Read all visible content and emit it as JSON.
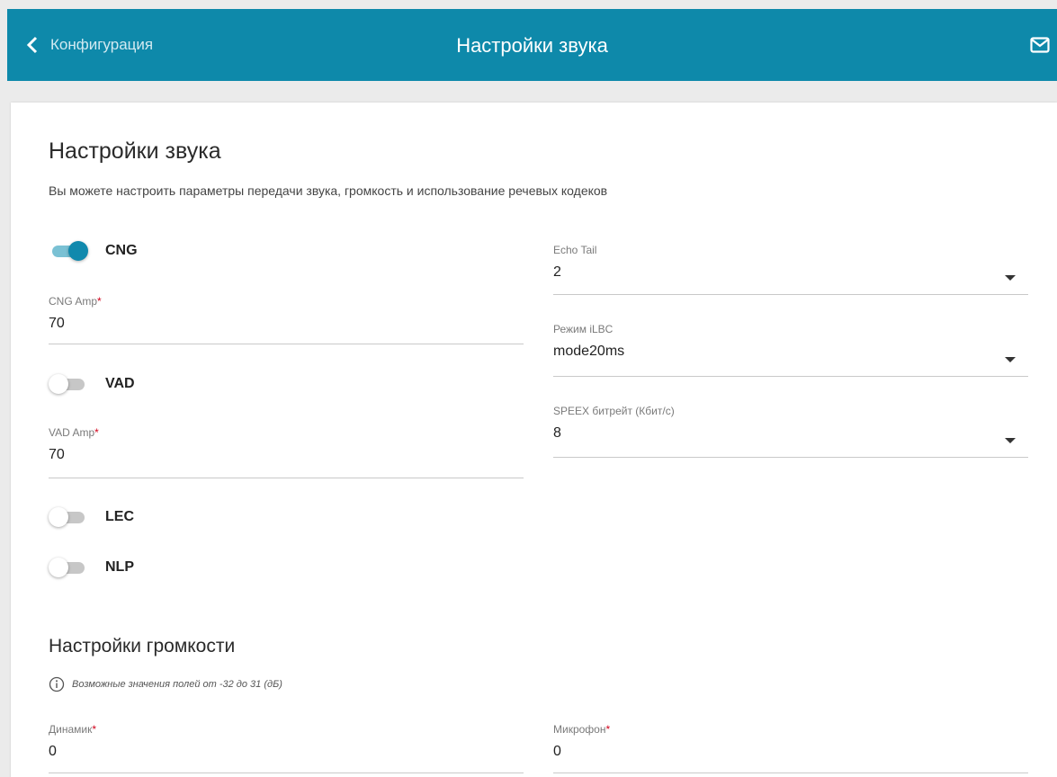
{
  "header": {
    "back_label": "Конфигурация",
    "title": "Настройки звука"
  },
  "section_sound": {
    "title": "Настройки звука",
    "description": "Вы можете настроить параметры передачи звука, громкость и использование речевых кодеков"
  },
  "toggles": {
    "cng": {
      "label": "CNG",
      "on": true
    },
    "vad": {
      "label": "VAD",
      "on": false
    },
    "lec": {
      "label": "LEC",
      "on": false
    },
    "nlp": {
      "label": "NLP",
      "on": false
    }
  },
  "fields": {
    "cng_amp": {
      "label": "CNG Amp",
      "required": "*",
      "value": "70"
    },
    "vad_amp": {
      "label": "VAD Amp",
      "required": "*",
      "value": "70"
    },
    "echo_tail": {
      "label": "Echo Tail",
      "value": "2"
    },
    "ilbc_mode": {
      "label": "Режим iLBC",
      "value": "mode20ms"
    },
    "speex_bitrate": {
      "label": "SPEEX битрейт (Кбит/с)",
      "value": "8"
    }
  },
  "section_volume": {
    "title": "Настройки громкости",
    "hint": "Возможные значения полей от -32 до 31 (дБ)",
    "speaker": {
      "label": "Динамик",
      "required": "*",
      "value": "0"
    },
    "microphone": {
      "label": "Микрофон",
      "required": "*",
      "value": "0"
    }
  },
  "colors": {
    "header_bg": "#0e89aa",
    "toggle_on": "#1189ad",
    "required": "#d0021b"
  }
}
